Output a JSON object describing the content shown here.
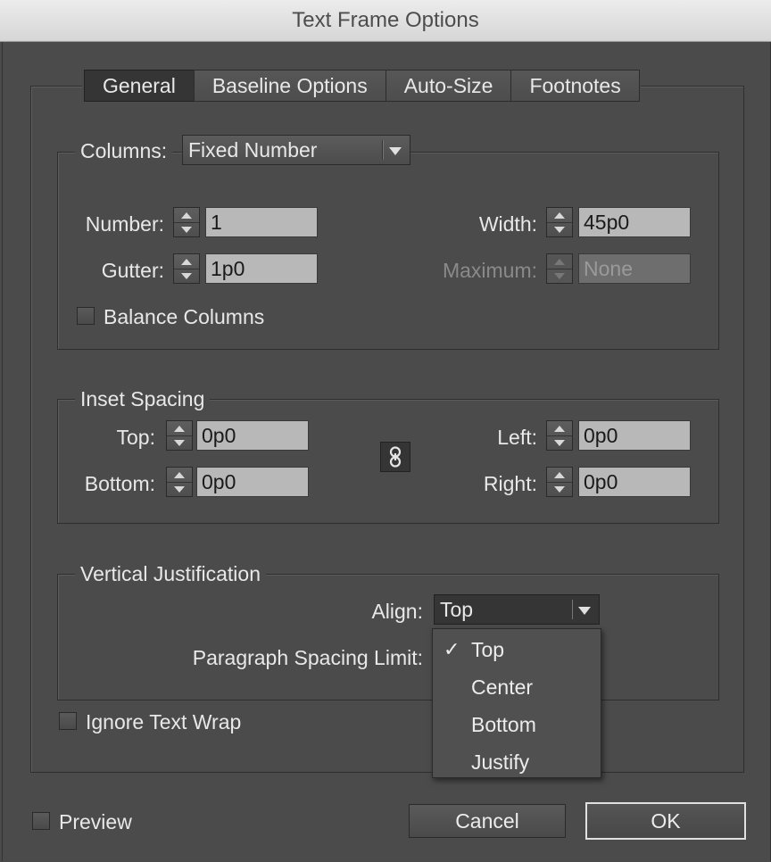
{
  "window": {
    "title": "Text Frame Options"
  },
  "tabs": [
    {
      "label": "General",
      "active": true
    },
    {
      "label": "Baseline Options",
      "active": false
    },
    {
      "label": "Auto-Size",
      "active": false
    },
    {
      "label": "Footnotes",
      "active": false
    }
  ],
  "columns": {
    "label": "Columns:",
    "type_value": "Fixed Number",
    "number": {
      "label": "Number:",
      "value": "1"
    },
    "gutter": {
      "label": "Gutter:",
      "value": "1p0"
    },
    "width": {
      "label": "Width:",
      "value": "45p0"
    },
    "maximum": {
      "label": "Maximum:",
      "value": "None",
      "enabled": false
    },
    "balance": {
      "label": "Balance Columns",
      "checked": false
    }
  },
  "inset": {
    "legend": "Inset Spacing",
    "top": {
      "label": "Top:",
      "value": "0p0"
    },
    "bottom": {
      "label": "Bottom:",
      "value": "0p0"
    },
    "left": {
      "label": "Left:",
      "value": "0p0"
    },
    "right": {
      "label": "Right:",
      "value": "0p0"
    },
    "link_icon": "chain-link-icon"
  },
  "vertical": {
    "legend": "Vertical Justification",
    "align": {
      "label": "Align:",
      "value": "Top"
    },
    "paragraph_spacing_limit": {
      "label": "Paragraph Spacing Limit:"
    },
    "options": [
      {
        "label": "Top",
        "selected": true
      },
      {
        "label": "Center",
        "selected": false
      },
      {
        "label": "Bottom",
        "selected": false
      },
      {
        "label": "Justify",
        "selected": false
      }
    ]
  },
  "ignore_wrap": {
    "label": "Ignore Text Wrap",
    "checked": false
  },
  "preview": {
    "label": "Preview",
    "checked": false
  },
  "buttons": {
    "cancel": "Cancel",
    "ok": "OK"
  }
}
